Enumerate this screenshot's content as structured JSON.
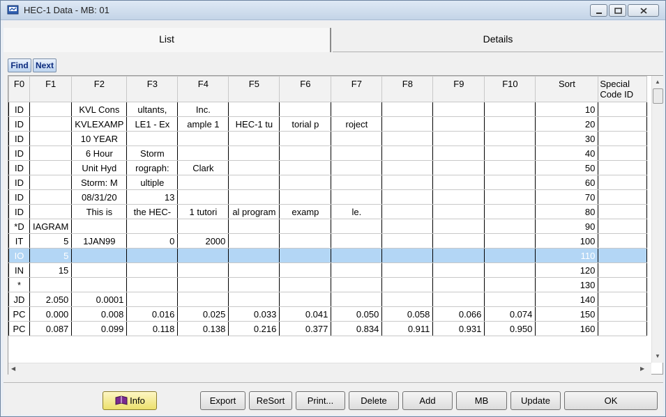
{
  "window": {
    "title": "HEC-1 Data - MB: 01"
  },
  "tabs": [
    {
      "label": "List"
    },
    {
      "label": "Details"
    }
  ],
  "nav": {
    "find": "Find",
    "next": "Next"
  },
  "columns": [
    "F0",
    "F1",
    "F2",
    "F3",
    "F4",
    "F5",
    "F6",
    "F7",
    "F8",
    "F9",
    "F10",
    "Sort",
    "Special Code ID"
  ],
  "rows": [
    [
      "ID",
      "",
      "KVL Cons",
      "ultants,",
      "Inc.",
      "",
      "",
      "",
      "",
      "",
      "",
      "10",
      ""
    ],
    [
      "ID",
      "",
      "KVLEXAMP",
      "LE1 - Ex",
      "ample 1",
      "HEC-1 tu",
      "torial p",
      "roject",
      "",
      "",
      "",
      "20",
      ""
    ],
    [
      "ID",
      "",
      "10 YEAR",
      "",
      "",
      "",
      "",
      "",
      "",
      "",
      "",
      "30",
      ""
    ],
    [
      "ID",
      "",
      "6 Hour",
      "Storm",
      "",
      "",
      "",
      "",
      "",
      "",
      "",
      "40",
      ""
    ],
    [
      "ID",
      "",
      "Unit Hyd",
      "rograph:",
      "Clark",
      "",
      "",
      "",
      "",
      "",
      "",
      "50",
      ""
    ],
    [
      "ID",
      "",
      "Storm: M",
      "ultiple",
      "",
      "",
      "",
      "",
      "",
      "",
      "",
      "60",
      ""
    ],
    [
      "ID",
      "",
      "08/31/20",
      "13",
      "",
      "",
      "",
      "",
      "",
      "",
      "",
      "70",
      ""
    ],
    [
      "ID",
      "",
      "This is",
      "the HEC-",
      "1 tutori",
      "al program",
      "examp",
      "le.",
      "",
      "",
      "",
      "80",
      ""
    ],
    [
      "*D",
      "IAGRAM",
      "",
      "",
      "",
      "",
      "",
      "",
      "",
      "",
      "",
      "90",
      ""
    ],
    [
      "IT",
      "5",
      "1JAN99",
      "0",
      "2000",
      "",
      "",
      "",
      "",
      "",
      "",
      "100",
      ""
    ],
    [
      "IO",
      "5",
      "",
      "",
      "",
      "",
      "",
      "",
      "",
      "",
      "",
      "110",
      ""
    ],
    [
      "IN",
      "15",
      "",
      "",
      "",
      "",
      "",
      "",
      "",
      "",
      "",
      "120",
      ""
    ],
    [
      "*",
      "",
      "",
      "",
      "",
      "",
      "",
      "",
      "",
      "",
      "",
      "130",
      ""
    ],
    [
      "JD",
      "2.050",
      "0.0001",
      "",
      "",
      "",
      "",
      "",
      "",
      "",
      "",
      "140",
      ""
    ],
    [
      "PC",
      "0.000",
      "0.008",
      "0.016",
      "0.025",
      "0.033",
      "0.041",
      "0.050",
      "0.058",
      "0.066",
      "0.074",
      "150",
      ""
    ],
    [
      "PC",
      "0.087",
      "0.099",
      "0.118",
      "0.138",
      "0.216",
      "0.377",
      "0.834",
      "0.911",
      "0.931",
      "0.950",
      "160",
      ""
    ]
  ],
  "selected_row": 10,
  "buttons": {
    "info": "Info",
    "export": "Export",
    "resort": "ReSort",
    "print": "Print...",
    "delete": "Delete",
    "add": "Add",
    "mb": "MB",
    "update": "Update",
    "ok": "OK"
  }
}
